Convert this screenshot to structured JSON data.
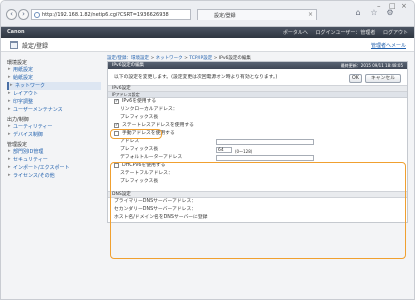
{
  "browser": {
    "url": "http://192.168.1.82/netip6.cgi?CSRT=1936626938",
    "tab_title": "設定/登録",
    "back_icon": "back-arrow-icon",
    "forward_icon": "forward-arrow-icon"
  },
  "header": {
    "logo": "Canon",
    "links": [
      "ポータルへ",
      "ログインユーザー：管理者",
      "ログアウト"
    ]
  },
  "subheader": {
    "title": "設定/登録",
    "mail_link": "管理者へメール"
  },
  "sidebar": {
    "groups": [
      {
        "label": "環境設定",
        "items": [
          "用紙設定",
          "給紙設定",
          "ネットワーク",
          "レイアウト",
          "印字調整",
          "ユーザーメンテナンス"
        ],
        "selected": 2
      },
      {
        "label": "出力/制御",
        "items": [
          "ユーティリティー",
          "デバイス制御"
        ],
        "selected": -1
      },
      {
        "label": "管理設定",
        "items": [
          "部門別ID管理",
          "セキュリティー",
          "インポート/エクスポート",
          "ライセンス/その他"
        ],
        "selected": -1
      }
    ]
  },
  "breadcrumb": {
    "parts": [
      "設定/登録：環境設定",
      "ネットワーク",
      "TCP/IP設定",
      "IPv6設定の編集"
    ]
  },
  "panel": {
    "title": "IPv6設定の編集",
    "last_updated": "最終更新：2015 09/11 18:48:05",
    "notice": "以下の設定を変更します。(設定変更は次回電源オン時より有効となります。)",
    "ok_label": "OK",
    "cancel_label": "キャンセル"
  },
  "ipv6": {
    "section_title": "IPv6設定",
    "subsection_title": "IPアドレス設定",
    "use_ipv6_label": "IPv6を使用する",
    "use_ipv6_checked": true,
    "link_local_label": "リンクローカルアドレス：",
    "prefix_len_label": "プレフィックス長",
    "stateless_label": "ステートレスアドレスを使用する",
    "stateless_checked": true,
    "manual_label": "手動アドレスを使用する",
    "manual_checked": false,
    "address_label": "アドレス",
    "address_value": "",
    "prefix_label": "プレフィックス長",
    "prefix_value": "64",
    "prefix_hint": "(0〜128)",
    "gateway_label": "デフォルトルーターアドレス",
    "gateway_value": "",
    "dhcp_label": "DHCPv6を使用する",
    "dhcp_checked": false,
    "stateful_label": "ステートフルアドレス：",
    "stateful_prefix_label": "プレフィックス長"
  },
  "dns": {
    "section_title": "DNS設定",
    "primary_label": "プライマリーDNSサーバーアドレス：",
    "secondary_label": "セカンダリーDNSサーバーアドレス：",
    "third_label": "ホスト名/ドメイン名をDNSサーバーに登録"
  },
  "colors": {
    "highlight": "#f0a030",
    "header": "#3f4756",
    "link": "#1f5fad"
  }
}
